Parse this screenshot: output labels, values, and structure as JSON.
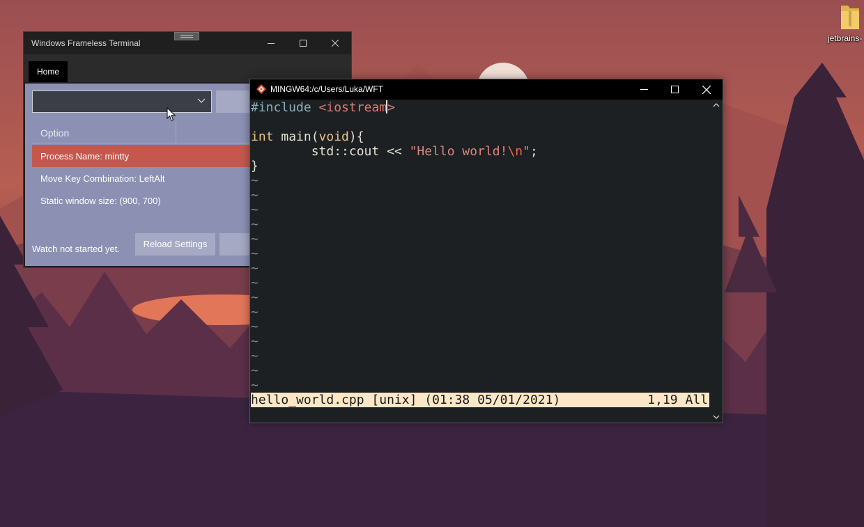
{
  "desktop": {
    "icon_label": "jetbrains-",
    "icon": "folder-icon"
  },
  "wft": {
    "title": "Windows Frameless Terminal",
    "tab_home": "Home",
    "combo_value": "",
    "column_option": "Option",
    "rows": [
      {
        "label": "Process Name:  mintty"
      },
      {
        "label": "Move Key Combination:  LeftAlt"
      },
      {
        "label": "Static window size: (900, 700)"
      }
    ],
    "status": "Watch not started yet.",
    "reload_button": "Reload Settings",
    "colors": {
      "accent_row": "#c4584f",
      "content_bg": "#8c91b4"
    }
  },
  "mintty": {
    "title": "MINGW64:/c/Users/Luka/WFT",
    "code": {
      "line1_pre": "#include ",
      "line1_inc": "<iostream",
      "line1_close": ">",
      "line3_type": "int",
      "line3_rest": " main(",
      "line3_void": "void",
      "line3_end": "){",
      "line4_indent": "        std::cout << ",
      "line4_str": "\"Hello world!",
      "line4_esc": "\\n",
      "line4_strend": "\"",
      "line4_semi": ";",
      "line5": "}"
    },
    "tilde": "~",
    "status_left": "hello_world.cpp [unix] (01:38 05/01/2021)",
    "status_right": "1,19 All"
  }
}
